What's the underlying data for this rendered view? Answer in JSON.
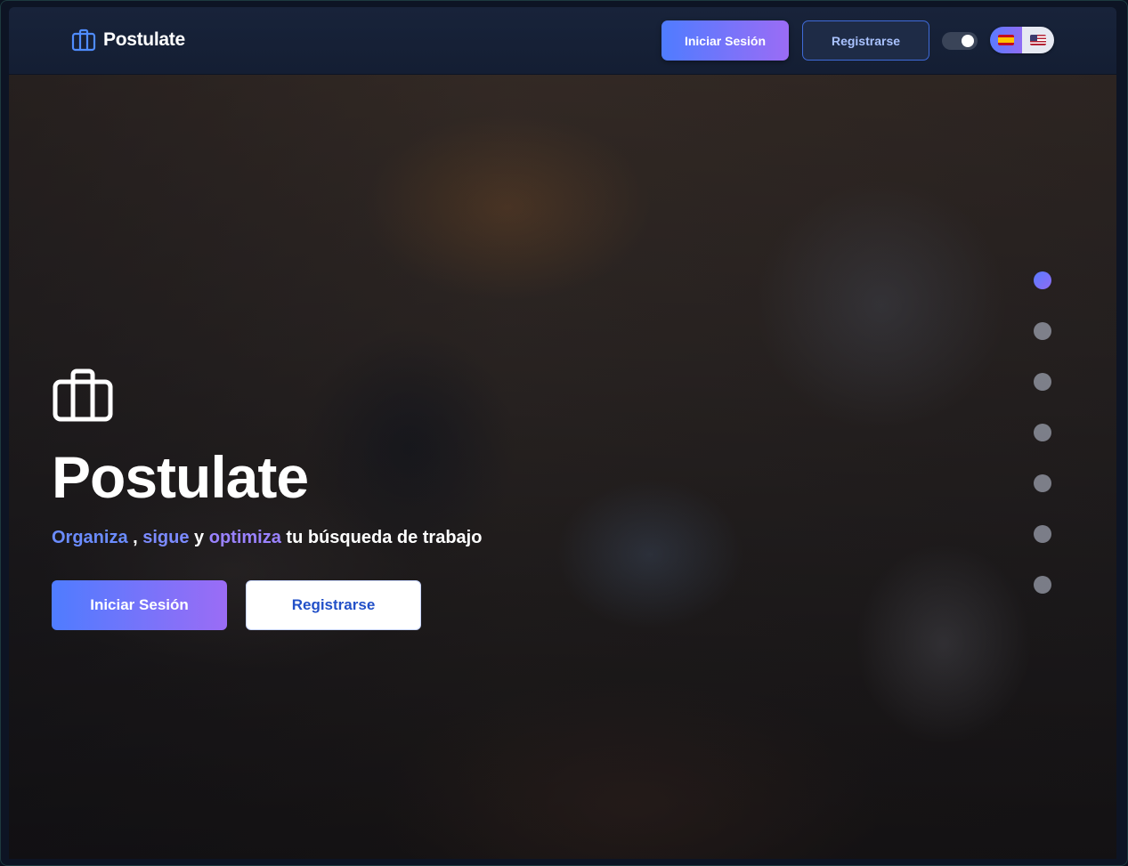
{
  "navbar": {
    "brand_name": "Postulate",
    "brand_icon": "briefcase-icon",
    "login_label": "Iniciar Sesión",
    "register_label": "Registrarse",
    "theme_toggle_icon": "toggle-icon",
    "languages": [
      {
        "code": "es",
        "icon": "flag-spain-icon",
        "active": true
      },
      {
        "code": "en",
        "icon": "flag-usa-icon",
        "active": false
      }
    ]
  },
  "hero": {
    "icon": "briefcase-icon",
    "title": "Postulate",
    "tagline": {
      "word1": "Organiza",
      "sep1": " , ",
      "word2": "sigue",
      "sep2": " y ",
      "word3": "optimiza",
      "rest": " tu búsqueda de trabajo"
    },
    "login_label": "Iniciar Sesión",
    "register_label": "Registrarse",
    "slides": {
      "count": 7,
      "active_index": 0
    }
  },
  "colors": {
    "accent_start": "#4f7cff",
    "accent_end": "#9b6cf5",
    "navbar_bg": "#18233a",
    "page_bg": "#0d1424"
  }
}
